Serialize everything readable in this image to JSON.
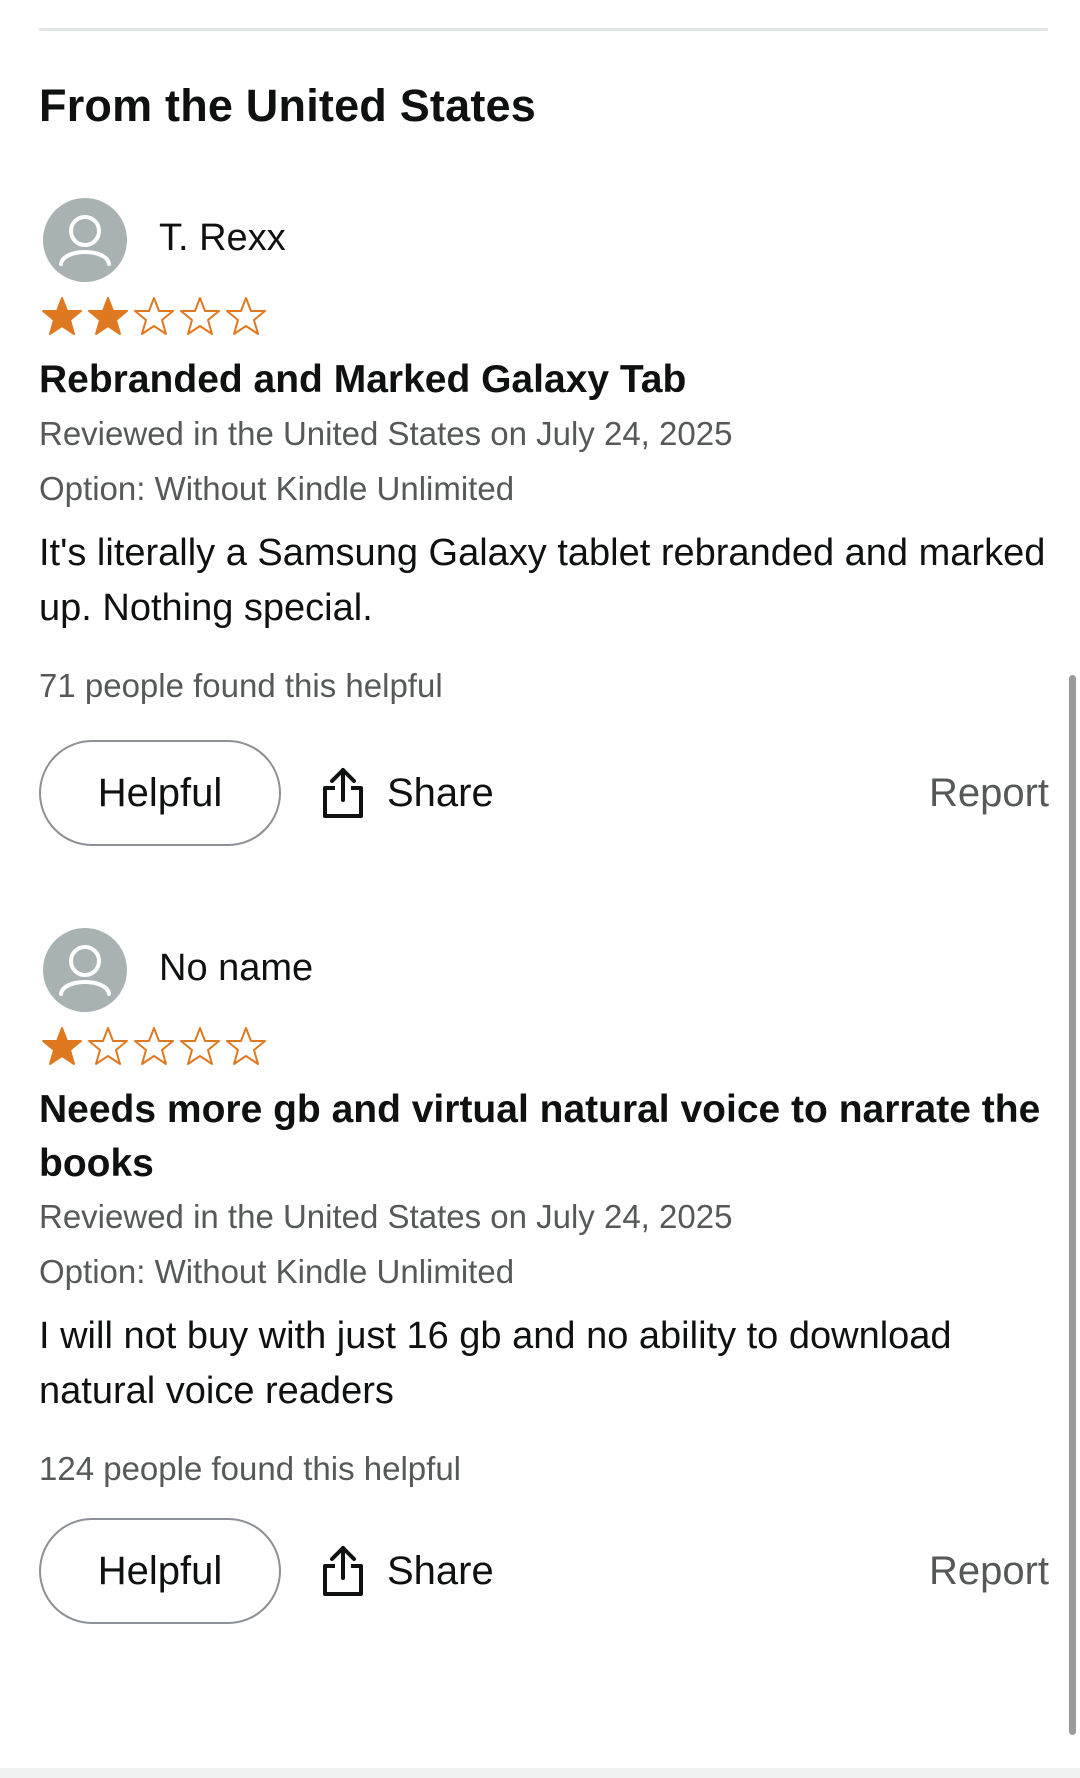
{
  "section": {
    "heading": "From the United States"
  },
  "reviews": [
    {
      "reviewer": "T. Rexx",
      "rating": 2,
      "rating_max": 5,
      "title": "Rebranded and Marked Galaxy Tab",
      "reviewed_line": "Reviewed in the United States on July 24, 2025",
      "option_line": "Option: Without Kindle Unlimited",
      "body": "It's literally a Samsung Galaxy tablet rebranded and marked up. Nothing special.",
      "helpful_count": "71 people found this helpful",
      "helpful_label": "Helpful",
      "share_label": "Share",
      "report_label": "Report"
    },
    {
      "reviewer": "No name",
      "rating": 1,
      "rating_max": 5,
      "title": "Needs more gb and virtual natural voice to narrate the books",
      "reviewed_line": "Reviewed in the United States on July 24, 2025",
      "option_line": "Option: Without Kindle Unlimited",
      "body": "I will not buy with just 16 gb and no ability to download natural voice readers",
      "helpful_count": "124 people found this helpful",
      "helpful_label": "Helpful",
      "share_label": "Share",
      "report_label": "Report"
    }
  ],
  "icons": {
    "avatar": "person-silhouette-icon",
    "star_filled": "star-filled-icon",
    "star_empty": "star-outline-icon",
    "share": "share-upload-icon"
  },
  "colors": {
    "star": "#de7921",
    "text_primary": "#0f1111",
    "text_secondary": "#565959",
    "avatar_bg": "#a9b2b2",
    "button_border": "#8d9096"
  }
}
